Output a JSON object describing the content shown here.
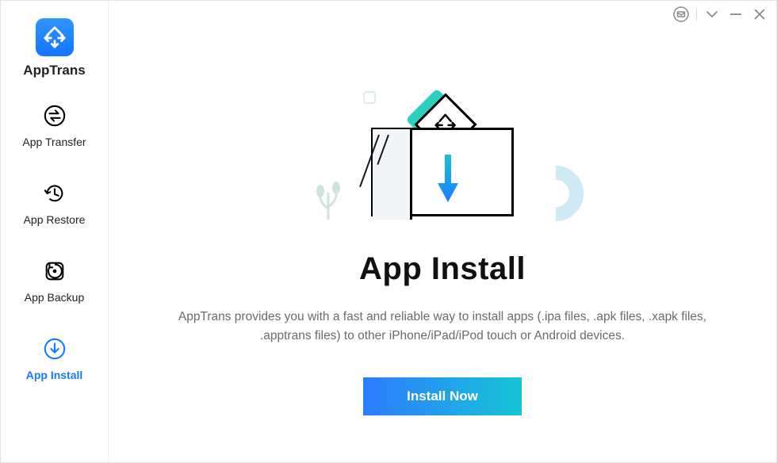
{
  "brand": "AppTrans",
  "sidebar": {
    "items": [
      {
        "label": "App Transfer"
      },
      {
        "label": "App Restore"
      },
      {
        "label": "App Backup"
      },
      {
        "label": "App Install"
      }
    ]
  },
  "main": {
    "title": "App Install",
    "description": "AppTrans provides you with a fast and reliable way to install apps (.ipa files, .apk files, .xapk files, .apptrans files) to other iPhone/iPad/iPod touch or Android devices.",
    "button": "Install Now"
  }
}
